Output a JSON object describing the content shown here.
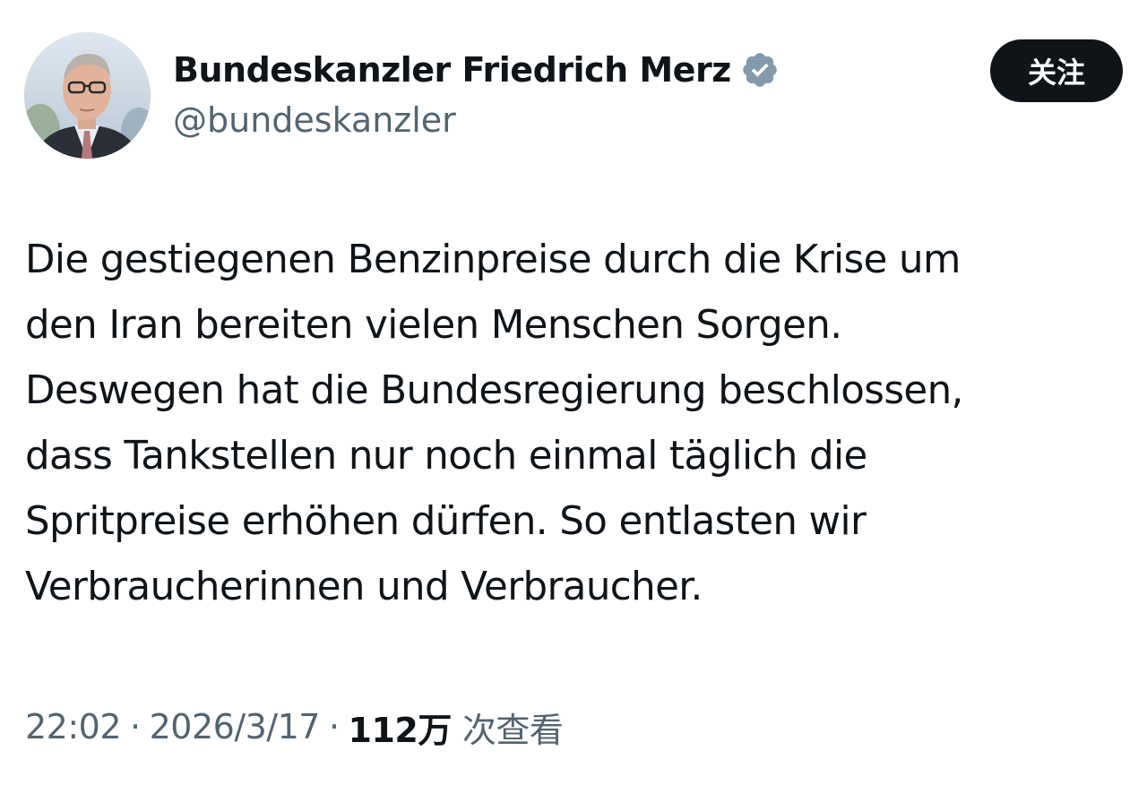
{
  "author": {
    "display_name": "Bundeskanzler Friedrich Merz",
    "handle": "@bundeskanzler",
    "verified_badge_icon": "verified-badge-icon",
    "verified_badge_color": "#829aab"
  },
  "follow_button": {
    "label": "关注",
    "background": "#0f1419",
    "text_color": "#ffffff"
  },
  "tweet": {
    "lines": [
      "Die gestiegenen Benzinpreise durch die Krise um",
      "den Iran bereiten vielen Menschen Sorgen.",
      "Deswegen hat die Bundesregierung beschlossen,",
      "dass Tankstellen nur noch einmal täglich die",
      "Spritpreise erhöhen dürfen. So entlasten wir",
      "Verbraucherinnen und Verbraucher."
    ]
  },
  "meta": {
    "time": "22:02",
    "separator": "·",
    "date": "2026/3/17",
    "views_count": "112万",
    "views_label": "次查看"
  }
}
